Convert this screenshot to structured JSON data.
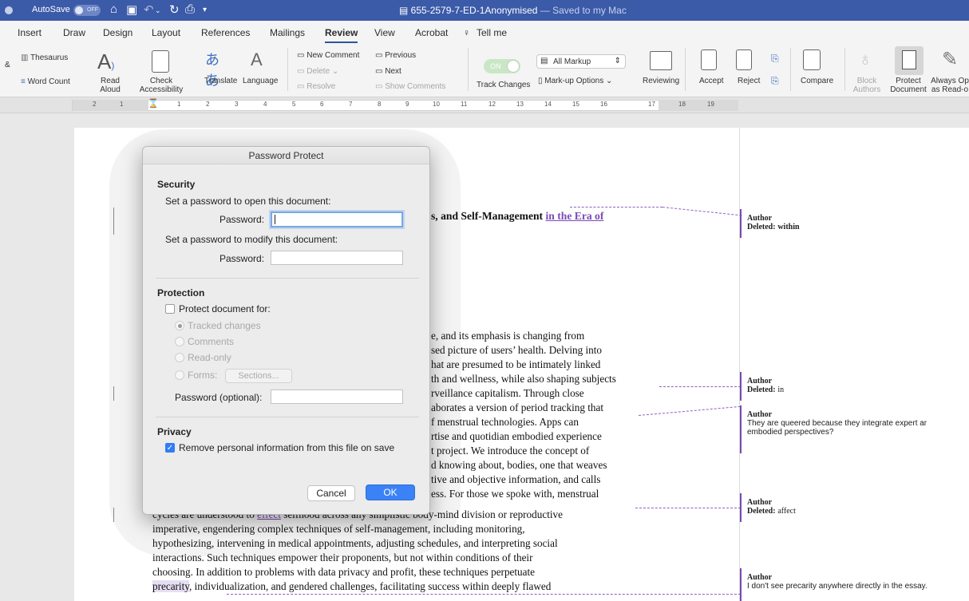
{
  "titlebar": {
    "autosave_label": "AutoSave",
    "autosave_state": "OFF",
    "doc_name": "655-2579-7-ED-1Anonymised",
    "saved_status": "— Saved to my Mac"
  },
  "tabs": [
    "Insert",
    "Draw",
    "Design",
    "Layout",
    "References",
    "Mailings",
    "Review",
    "View",
    "Acrobat",
    "Tell me"
  ],
  "active_tab": "Review",
  "ribbon": {
    "thesaurus": "Thesaurus",
    "word_count": "Word Count",
    "read_aloud_1": "Read",
    "read_aloud_2": "Aloud",
    "check_access_1": "Check",
    "check_access_2": "Accessibility",
    "translate": "Translate",
    "language": "Language",
    "new_comment": "New Comment",
    "delete": "Delete",
    "resolve": "Resolve",
    "previous": "Previous",
    "next": "Next",
    "show_comments": "Show Comments",
    "track_toggle": "ON",
    "track_changes": "Track Changes",
    "markup_select": "All Markup",
    "markup_options": "Mark-up Options",
    "reviewing": "Reviewing",
    "accept": "Accept",
    "reject": "Reject",
    "compare": "Compare",
    "block_1": "Block",
    "block_2": "Authors",
    "protect_1": "Protect",
    "protect_2": "Document",
    "always_1": "Always Op",
    "always_2": "as Read-o"
  },
  "ruler_numbers": [
    "2",
    "1",
    "1",
    "2",
    "3",
    "4",
    "5",
    "6",
    "7",
    "8",
    "9",
    "10",
    "11",
    "12",
    "13",
    "14",
    "15",
    "16",
    "17",
    "18",
    "19"
  ],
  "document": {
    "heading_text": "s, and Self-Management ",
    "heading_insert": "in the Era of",
    "lines": [
      "e, and its emphasis is changing from",
      "sed picture of users’ health. Delving into",
      "hat are presumed to be intimately linked",
      "th and wellness, while also shaping subjects",
      "rveillance capitalism. Through close",
      "aborates a version of period tracking that",
      "f menstrual technologies. Apps can",
      "rtise and quotidian embodied experience",
      "t project. We introduce the concept of",
      "d knowing about, bodies, one that weaves",
      "tive and objective information, and calls",
      "ess. For those we spoke with, menstrual"
    ],
    "line_effect_pre": "cycles are understood to ",
    "line_effect_ins": "effect",
    "line_effect_post": " selfhood across any simplistic body-mind division or reproductive",
    "full_lines": [
      "imperative, engendering complex techniques of self-management, including monitoring,",
      "hypothesizing, intervening in medical appointments, adjusting schedules, and interpreting social",
      "interactions. Such techniques empower their proponents, but not within conditions of their",
      "choosing. In addition to problems with data privacy and profit, these techniques perpetuate"
    ],
    "last_line_hl": "precarity",
    "last_line_post": ", individualization, and gendered challenges, facilitating success within deeply flawed"
  },
  "comments": [
    {
      "author": "Author",
      "label": "Deleted:",
      "value": "within"
    },
    {
      "author": "Author",
      "label": "Deleted:",
      "value": "in"
    },
    {
      "author": "Author",
      "text1": "They are queered because they integrate expert ar",
      "text2": "embodied perspectives?"
    },
    {
      "author": "Author",
      "label": "Deleted:",
      "value": "affect"
    },
    {
      "author": "Author",
      "text1": "I don't see precarity anywhere directly in the essay."
    }
  ],
  "dialog": {
    "title": "Password Protect",
    "security_heading": "Security",
    "open_label": "Set a password to open this document:",
    "password_label": "Password:",
    "modify_label": "Set a password to modify this document:",
    "protection_heading": "Protection",
    "protect_for": "Protect document for:",
    "opt_tracked": "Tracked changes",
    "opt_comments": "Comments",
    "opt_readonly": "Read-only",
    "opt_forms": "Forms:",
    "sections_btn": "Sections...",
    "password_optional": "Password (optional):",
    "privacy_heading": "Privacy",
    "remove_info": "Remove personal information from this file on save",
    "cancel": "Cancel",
    "ok": "OK"
  }
}
